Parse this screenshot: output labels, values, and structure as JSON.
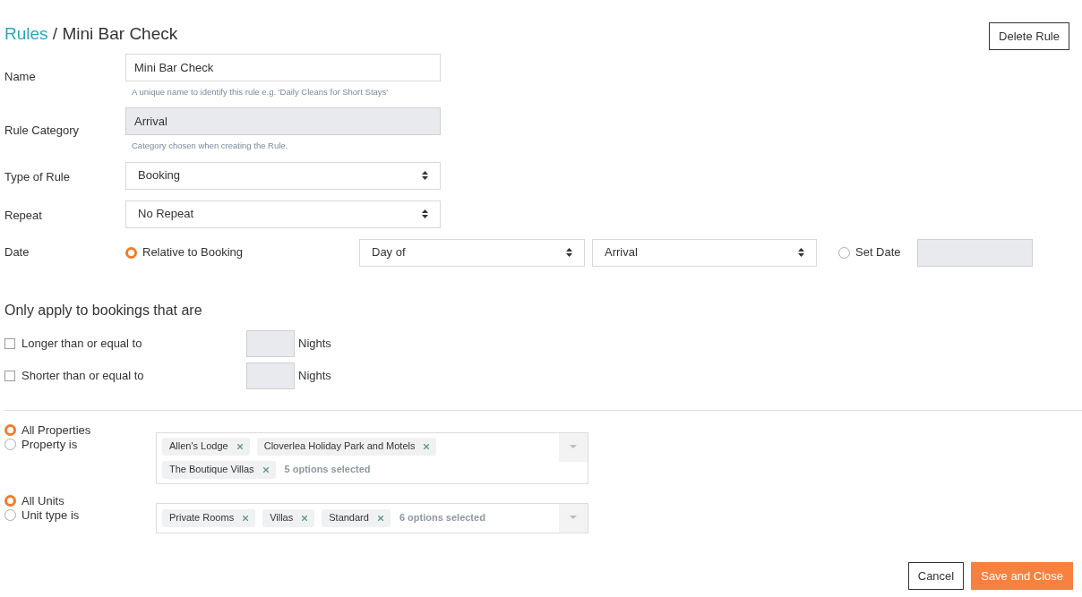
{
  "header": {
    "breadcrumb_link": "Rules",
    "separator": "/",
    "title": "Mini Bar Check"
  },
  "delete_button": "Delete Rule",
  "fields": [
    {
      "kind": "text",
      "label": "Name",
      "value": "Mini Bar Check",
      "hint": "A unique name to identify this rule e.g. 'Daily Cleans for Short Stays'"
    },
    {
      "kind": "readonly",
      "label": "Rule Category",
      "value": "Arrival",
      "hint": "Category chosen when creating the Rule."
    },
    {
      "kind": "select",
      "label": "Type of Rule",
      "value": "Booking"
    },
    {
      "kind": "select",
      "label": "Repeat",
      "value": "No Repeat"
    }
  ],
  "date": {
    "label": "Date",
    "relative": {
      "label": "Relative to Booking",
      "selected": true
    },
    "offset": "Day of",
    "anchor": "Arrival",
    "set_date": {
      "label": "Set Date",
      "selected": false
    }
  },
  "filter": {
    "heading": "Only apply to bookings that are",
    "conditions": [
      {
        "label": "Longer than or equal to",
        "checked": false,
        "unit": "Nights"
      },
      {
        "label": "Shorter than or equal to",
        "checked": false,
        "unit": "Nights"
      }
    ]
  },
  "scopes": [
    {
      "options": [
        {
          "label": "All Properties",
          "selected": true
        },
        {
          "label": "Property is",
          "selected": false
        }
      ],
      "tags": [
        "Allen's Lodge",
        "Cloverlea Holiday Park and Motels",
        "The Boutique Villas"
      ],
      "summary": "5 options selected"
    },
    {
      "options": [
        {
          "label": "All Units",
          "selected": true
        },
        {
          "label": "Unit type is",
          "selected": false
        }
      ],
      "tags": [
        "Private Rooms",
        "Villas",
        "Standard"
      ],
      "summary": "6 options selected"
    }
  ],
  "footer": {
    "cancel": "Cancel",
    "save": "Save and Close"
  }
}
